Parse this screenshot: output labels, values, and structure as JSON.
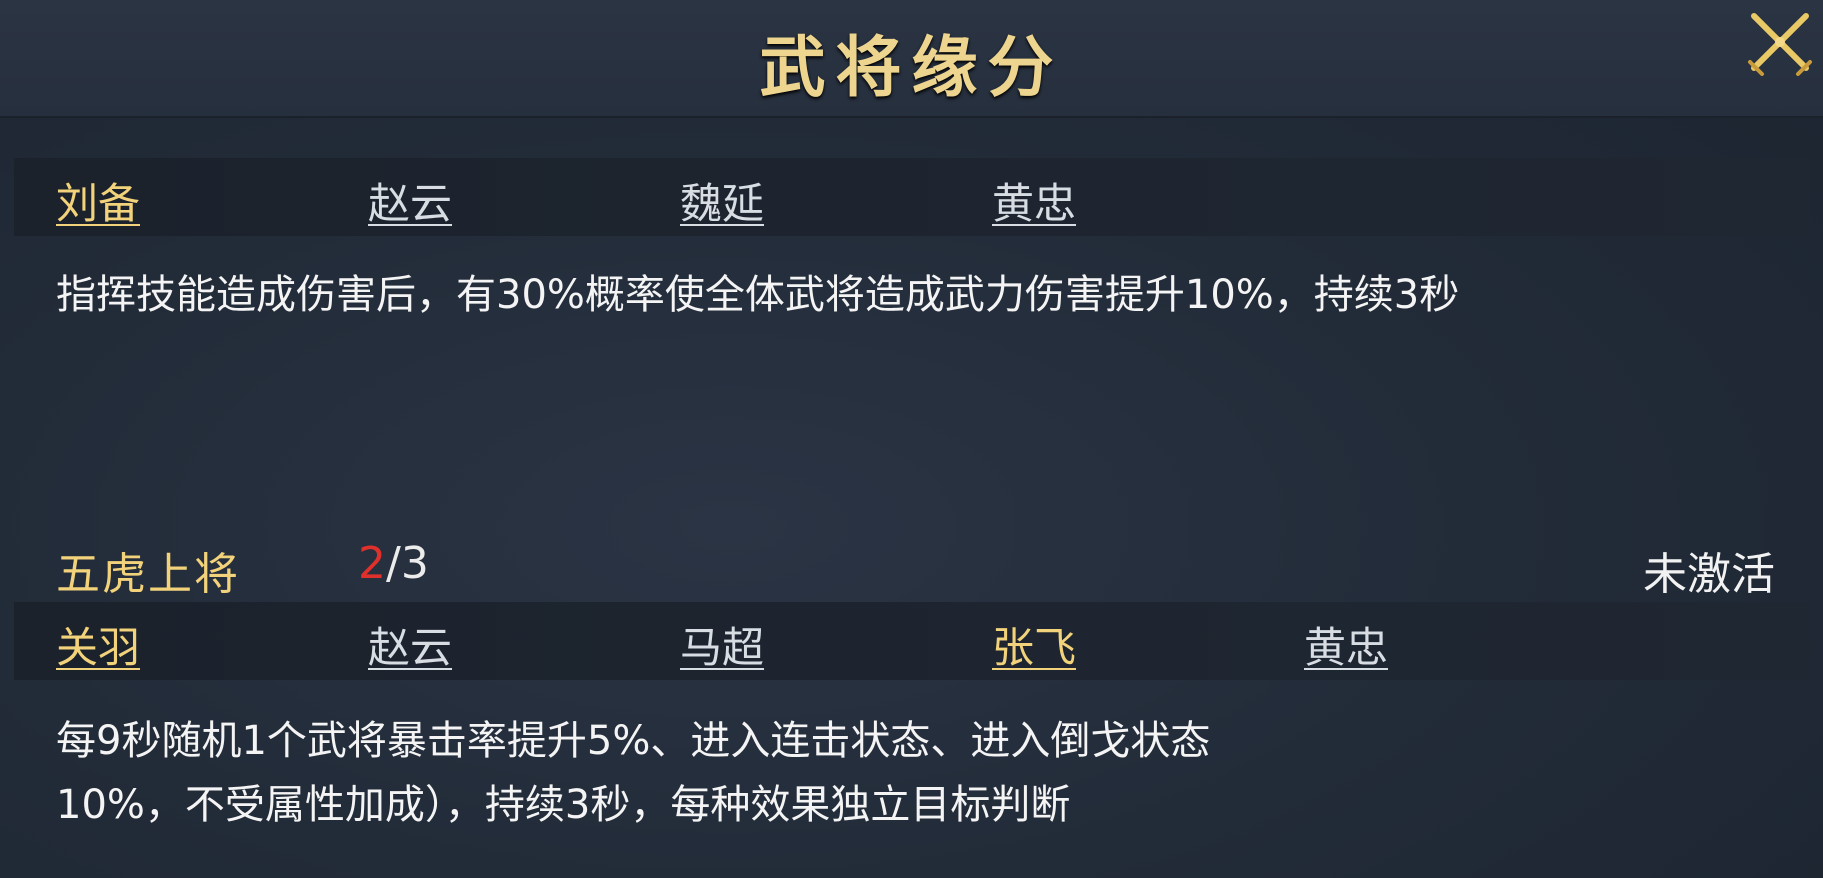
{
  "header": {
    "title": "武将缘分",
    "close_icon": "crossed-swords-close-icon"
  },
  "bond1": {
    "heroes": [
      {
        "name": "刘备",
        "active": true
      },
      {
        "name": "赵云",
        "active": false
      },
      {
        "name": "魏延",
        "active": false
      },
      {
        "name": "黄忠",
        "active": false
      }
    ],
    "description": "指挥技能造成伤害后，有30%概率使全体武将造成武力伤害提升10%，持续3秒"
  },
  "bond2": {
    "name": "五虎上将",
    "progress_current": "2",
    "progress_total": "/3",
    "status": "未激活",
    "heroes": [
      {
        "name": "关羽",
        "active": true
      },
      {
        "name": "赵云",
        "active": false
      },
      {
        "name": "马超",
        "active": false
      },
      {
        "name": "张飞",
        "active": true
      },
      {
        "name": "黄忠",
        "active": false
      }
    ],
    "description_line1": "每9秒随机1个武将暴击率提升5%、进入连击状态、进入倒戈状态",
    "description_line2": "10%，不受属性加成），持续3秒，每种效果独立目标判断"
  },
  "colors": {
    "accent_gold": "#f2d27a",
    "inactive_text": "#d8dde4",
    "progress_red": "#e0302b",
    "background": "#222b38"
  }
}
